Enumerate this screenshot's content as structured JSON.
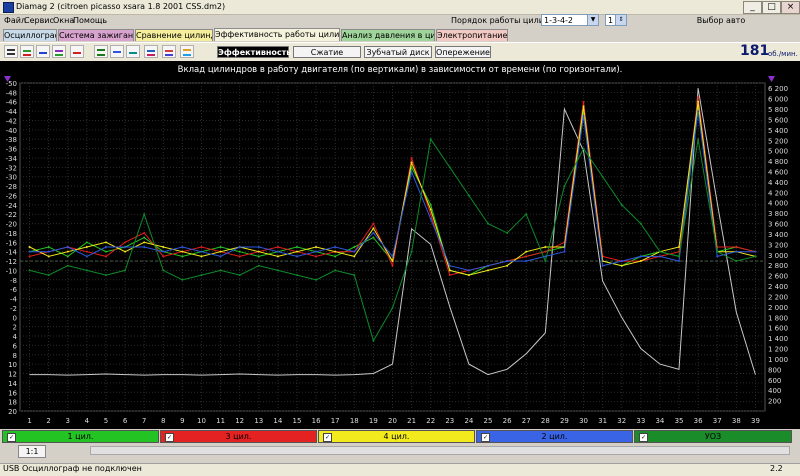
{
  "window": {
    "title": "Diamag 2 (citroen picasso xsara 1.8 2001 CSS.dm2)",
    "minimize": "_",
    "maximize": "□",
    "close": "×"
  },
  "menu": {
    "items": [
      "Файл",
      "Сервис",
      "Окна",
      "Помощь"
    ]
  },
  "cylinder_order": {
    "label": "Порядок работы цилиндров",
    "value": "1-3-4-2",
    "stepper_value": "1"
  },
  "select_car": "Выбор авто",
  "tabs": [
    {
      "label": "Осциллограф",
      "color": "#c9dbe8"
    },
    {
      "label": "Система зажигания",
      "color": "#d8a3cf"
    },
    {
      "label": "Сравнение цилиндров",
      "color": "#f5ef9c"
    },
    {
      "label": "Эффективность работы цилиндров",
      "color": "#f6f3dc"
    },
    {
      "label": "Анализ давления в цилиндре",
      "color": "#9fd59a"
    },
    {
      "label": "Электропитание",
      "color": "#f2c9c3"
    }
  ],
  "subtabs": [
    "Эффективность",
    "Сжатие (дизель)",
    "Зубчатый диск",
    "Опережение"
  ],
  "rpm": {
    "value": "181",
    "unit": "об./мин."
  },
  "toolbar_icons": [
    "list-icon",
    "bars-icon",
    "curve-icon",
    "wave-icon",
    "arrows-icon",
    "grid-icon",
    "print-icon",
    "ruler-icon",
    "table-icon",
    "chart-icon",
    "palette-icon"
  ],
  "chart_data": {
    "type": "line",
    "title": "Вклад цилиндров в работу двигателя (по вертикали) в зависимости от времени (по горизонтали).",
    "x_ticks": [
      "1",
      "2",
      "3",
      "4",
      "5",
      "6",
      "7",
      "8",
      "9",
      "10",
      "11",
      "12",
      "13",
      "14",
      "15",
      "16",
      "17",
      "18",
      "19",
      "20",
      "21",
      "22",
      "23",
      "24",
      "25",
      "26",
      "27",
      "28",
      "29",
      "30",
      "31",
      "32",
      "33",
      "34",
      "35",
      "36",
      "37",
      "38",
      "39"
    ],
    "left_axis_ticks": [
      "-50",
      "-48",
      "-46",
      "-44",
      "-42",
      "-40",
      "-38",
      "-36",
      "-34",
      "-32",
      "-30",
      "-28",
      "-26",
      "-24",
      "-22",
      "-20",
      "-18",
      "-16",
      "-14",
      "-12",
      "-10",
      "-8",
      "-6",
      "-4",
      "-2",
      "0",
      "2",
      "4",
      "6",
      "8",
      "10",
      "12",
      "14",
      "16",
      "18",
      "20"
    ],
    "right_axis_ticks": [
      "6 200",
      "6 000",
      "5 800",
      "5 600",
      "5 400",
      "5 200",
      "5 000",
      "4 800",
      "4 600",
      "4 400",
      "4 200",
      "4 000",
      "3 800",
      "3 600",
      "3 400",
      "3 200",
      "3 000",
      "2 800",
      "2 600",
      "2 400",
      "2 200",
      "2 000",
      "1 800",
      "1 600",
      "1 400",
      "1 200",
      "1 000",
      "800",
      "600",
      "400",
      "200"
    ],
    "left_range": [
      -50,
      20
    ],
    "right_range": [
      0,
      6300
    ],
    "grid": true,
    "series": [
      {
        "name": "1 цил.",
        "color": "#23c623",
        "values": [
          -14,
          -15,
          -13,
          -16,
          -14,
          -15,
          -17,
          -14,
          -13,
          -14,
          -15,
          -14,
          -13,
          -14,
          -15,
          -14,
          -13,
          -15,
          -17,
          -12,
          -32,
          -24,
          -10,
          -9,
          -11,
          -12,
          -13,
          -14,
          -15,
          -44,
          -12,
          -11,
          -13,
          -14,
          -13,
          -45,
          -14,
          -15,
          -14
        ]
      },
      {
        "name": "3 цил.",
        "color": "#e81c1c",
        "values": [
          -13,
          -14,
          -15,
          -14,
          -13,
          -16,
          -18,
          -13,
          -14,
          -15,
          -14,
          -13,
          -14,
          -15,
          -14,
          -13,
          -14,
          -14,
          -20,
          -11,
          -34,
          -22,
          -9,
          -10,
          -11,
          -12,
          -13,
          -14,
          -16,
          -46,
          -13,
          -12,
          -12,
          -13,
          -14,
          -47,
          -15,
          -15,
          -14
        ]
      },
      {
        "name": "4 цил.",
        "color": "#f0e81a",
        "values": [
          -15,
          -13,
          -14,
          -15,
          -16,
          -14,
          -16,
          -15,
          -14,
          -13,
          -14,
          -15,
          -14,
          -13,
          -14,
          -15,
          -14,
          -13,
          -19,
          -12,
          -33,
          -23,
          -10,
          -9,
          -10,
          -11,
          -14,
          -15,
          -15,
          -45,
          -12,
          -11,
          -12,
          -14,
          -15,
          -46,
          -14,
          -14,
          -13
        ]
      },
      {
        "name": "2 цил.",
        "color": "#2d57e0",
        "values": [
          -14,
          -14,
          -15,
          -13,
          -15,
          -15,
          -15,
          -14,
          -15,
          -14,
          -13,
          -15,
          -15,
          -14,
          -13,
          -14,
          -15,
          -14,
          -18,
          -13,
          -31,
          -21,
          -11,
          -10,
          -11,
          -12,
          -12,
          -13,
          -14,
          -43,
          -11,
          -12,
          -13,
          -13,
          -12,
          -44,
          -13,
          -14,
          -14
        ]
      },
      {
        "name": "УОЗ",
        "color": "#0e8a2a",
        "values": [
          -10,
          -9,
          -11,
          -10,
          -9,
          -10,
          -22,
          -10,
          -8,
          -9,
          -10,
          -9,
          -11,
          -10,
          -9,
          -8,
          -10,
          -9,
          5,
          -2,
          -14,
          -38,
          -32,
          -26,
          -20,
          -18,
          -22,
          -12,
          -28,
          -36,
          -30,
          -24,
          -20,
          -14,
          -13,
          -38,
          -14,
          -12,
          -13
        ]
      }
    ],
    "rpm_series": {
      "color": "#c8c8c8",
      "values": [
        700,
        700,
        690,
        700,
        710,
        700,
        690,
        700,
        700,
        690,
        700,
        710,
        700,
        690,
        700,
        700,
        690,
        700,
        720,
        900,
        3500,
        3200,
        2000,
        900,
        700,
        800,
        1100,
        1500,
        5800,
        5000,
        2500,
        1800,
        1200,
        900,
        800,
        6200,
        4000,
        1900,
        700
      ]
    }
  },
  "channels": [
    {
      "label": "1 цил.",
      "color": "#22c322",
      "checked": "✓"
    },
    {
      "label": "3 цил.",
      "color": "#e52222",
      "checked": "✓"
    },
    {
      "label": "4 цил.",
      "color": "#f2ea1c",
      "checked": "✓"
    },
    {
      "label": "2 цил.",
      "color": "#3a64e6",
      "checked": "✓"
    },
    {
      "label": "УОЗ",
      "color": "#1a8c2a",
      "checked": "✓"
    }
  ],
  "scale": "1:1",
  "status": {
    "text": "USB Осциллограф не подключен",
    "value": "2.2"
  }
}
